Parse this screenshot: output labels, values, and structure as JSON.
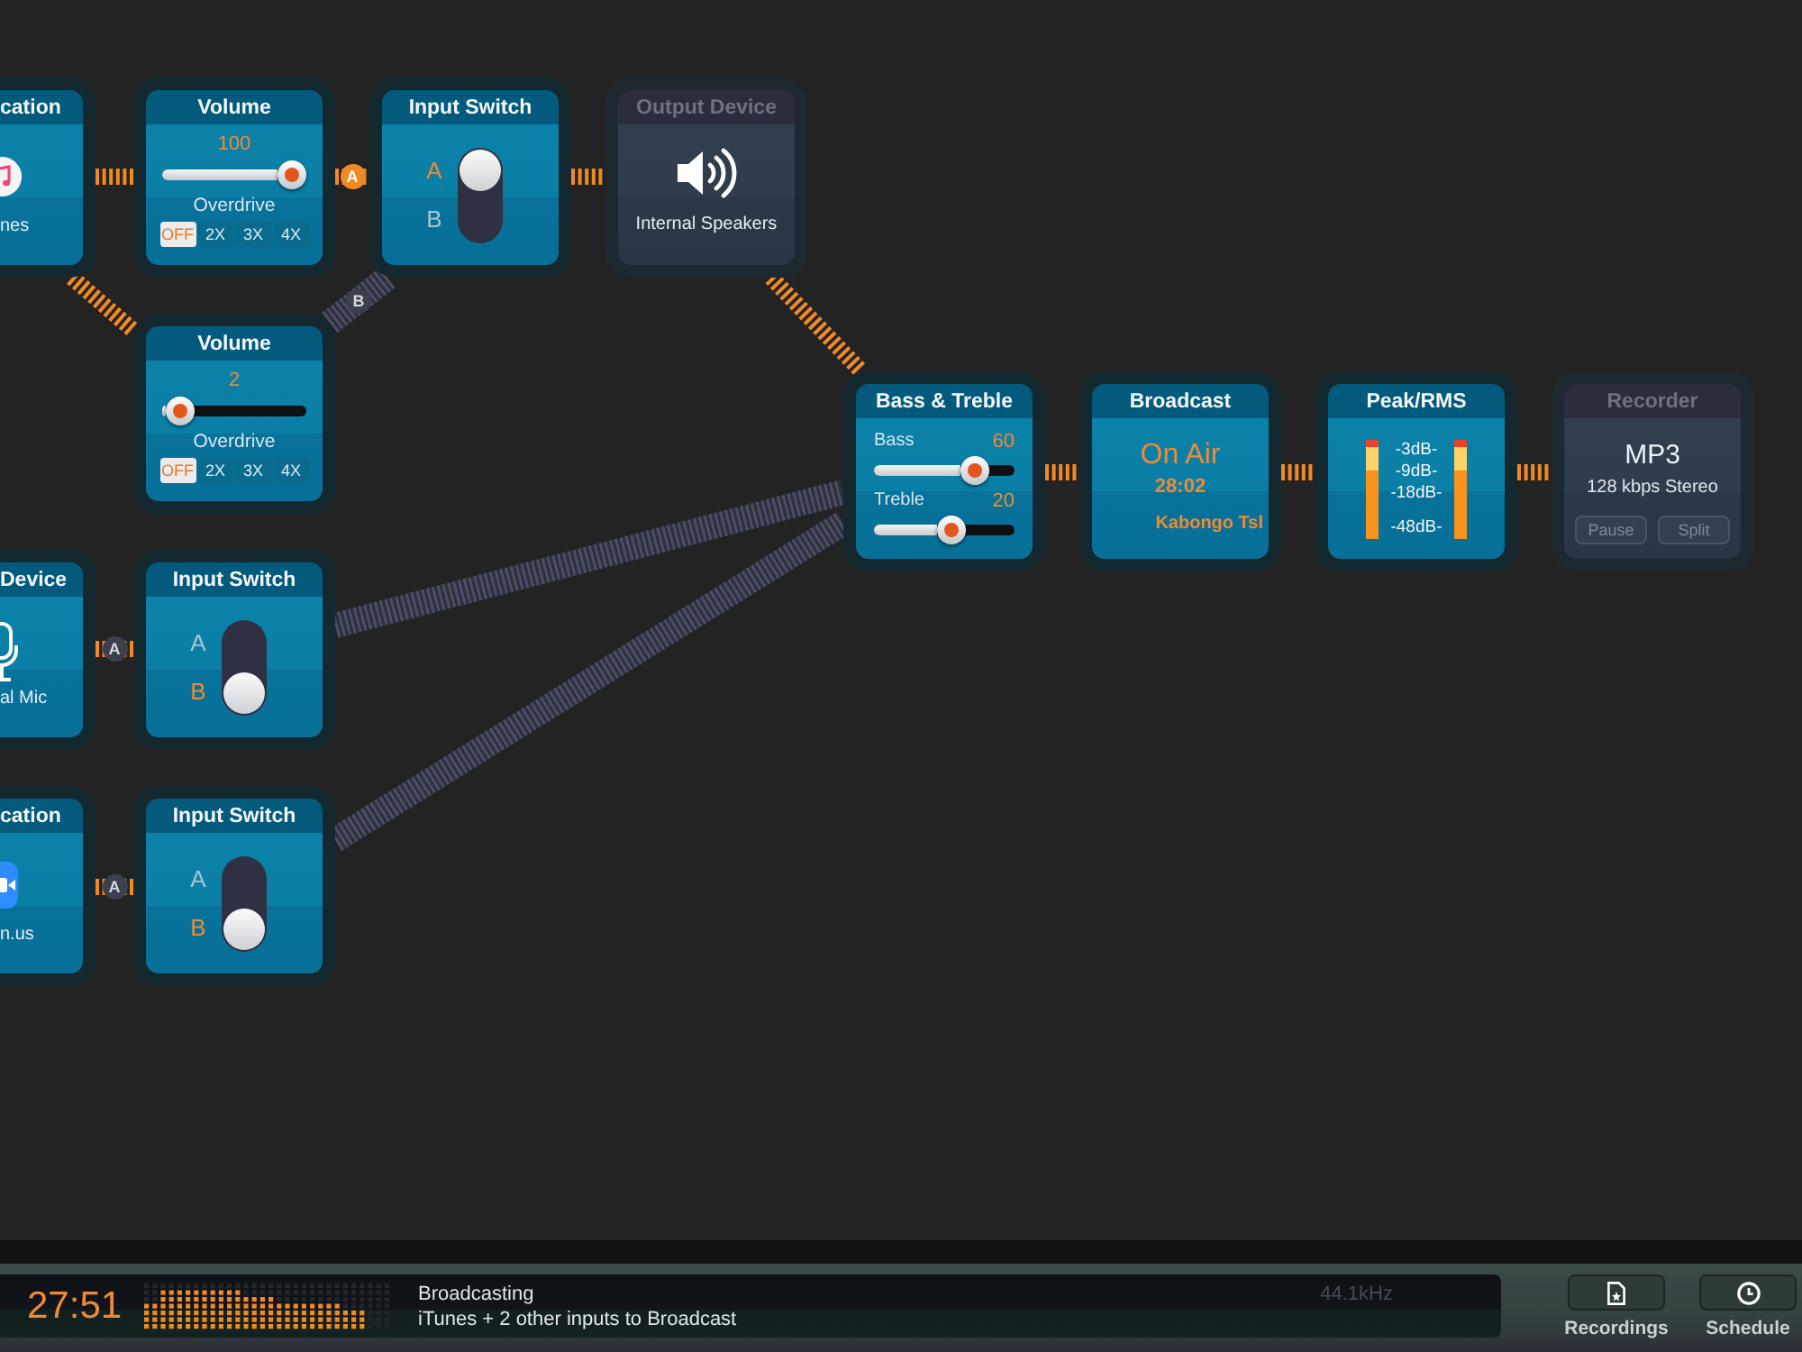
{
  "nodes": [
    {
      "kind": "application",
      "title": "cation",
      "label": "nes",
      "disabled": false
    },
    {
      "kind": "volume",
      "title": "Volume",
      "value": "100",
      "level": 1,
      "caption": "Overdrive",
      "options": [
        {
          "label": "OFF",
          "selected": true
        },
        {
          "label": "2X",
          "selected": false
        },
        {
          "label": "3X",
          "selected": false
        },
        {
          "label": "4X",
          "selected": false
        }
      ],
      "disabled": false
    },
    {
      "kind": "input_switch",
      "title": "Input Switch",
      "inputs": [
        {
          "label": "A",
          "selected": true
        },
        {
          "label": "B",
          "selected": false
        }
      ],
      "disabled": false
    },
    {
      "kind": "output_device",
      "title": "Output Device",
      "label": "Internal Speakers",
      "disabled": true
    },
    {
      "kind": "volume",
      "title": "Volume",
      "value": "2",
      "level": 0,
      "caption": "Overdrive",
      "options": [
        {
          "label": "OFF",
          "selected": true
        },
        {
          "label": "2X",
          "selected": false
        },
        {
          "label": "3X",
          "selected": false
        },
        {
          "label": "4X",
          "selected": false
        }
      ],
      "disabled": false
    },
    {
      "kind": "bass_treble",
      "title": "Bass & Treble",
      "controls": [
        {
          "label": "Bass",
          "value": "60",
          "level": 0.77
        },
        {
          "label": "Treble",
          "value": "20",
          "level": 0.57
        }
      ],
      "disabled": false
    },
    {
      "kind": "broadcast",
      "title": "Broadcast",
      "status": "On Air",
      "time": "28:02",
      "name": "Kabongo Tsl",
      "disabled": false
    },
    {
      "kind": "peak_rms",
      "title": "Peak/RMS",
      "meters": [
        {
          "level": 1
        },
        {
          "level": 1
        }
      ],
      "scale": [
        "-3dB-",
        "-9dB-",
        "-18dB-",
        "-48dB-"
      ],
      "disabled": false
    },
    {
      "kind": "recorder",
      "title": "Recorder",
      "format": "MP3",
      "detail": "128 kbps Stereo",
      "buttons": [
        {
          "label": "Pause",
          "disabled": true
        },
        {
          "label": "Split",
          "disabled": true
        }
      ],
      "disabled": true
    },
    {
      "kind": "input_device",
      "title": "Device",
      "label": "al Mic",
      "disabled": false
    },
    {
      "kind": "input_switch",
      "title": "Input Switch",
      "inputs": [
        {
          "label": "A",
          "selected": false
        },
        {
          "label": "B",
          "selected": true
        }
      ],
      "disabled": false
    },
    {
      "kind": "application",
      "title": "cation",
      "label": "n.us",
      "disabled": false
    },
    {
      "kind": "input_switch",
      "title": "Input Switch",
      "inputs": [
        {
          "label": "A",
          "selected": false
        },
        {
          "label": "B",
          "selected": true
        }
      ],
      "disabled": false
    }
  ],
  "connections": [
    {
      "active": true
    },
    {
      "active": true,
      "badge": {
        "label": "A",
        "selected": true
      }
    },
    {
      "active": true
    },
    {
      "active": false,
      "badge": {
        "label": "B",
        "selected": false
      }
    },
    {
      "active": true
    },
    {
      "active": true
    },
    {
      "active": true,
      "badge": {
        "label": "A",
        "selected": false
      }
    },
    {
      "active": false
    },
    {
      "active": true,
      "badge": {
        "label": "A",
        "selected": false
      }
    },
    {
      "active": false
    },
    {
      "active": true
    },
    {
      "active": true
    },
    {
      "active": true
    }
  ],
  "status_bar": {
    "time": "27:51",
    "title": "Broadcasting",
    "detail": "iTunes + 2 other inputs to Broadcast",
    "sample_rate": "44.1kHz",
    "buttons": [
      {
        "kind": "recordings",
        "label": "Recordings"
      },
      {
        "kind": "schedule",
        "label": "Schedule"
      }
    ]
  }
}
